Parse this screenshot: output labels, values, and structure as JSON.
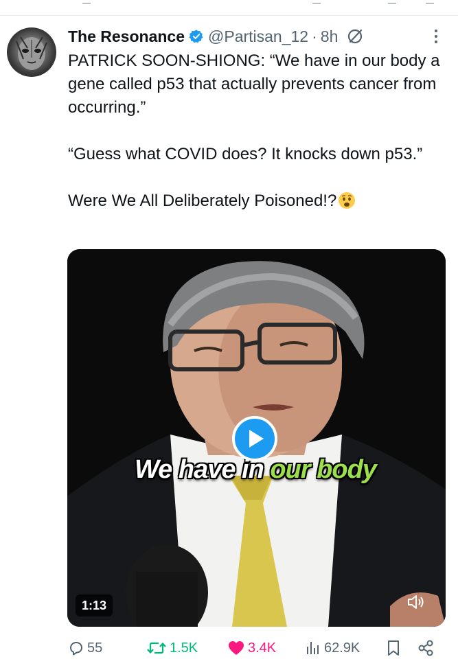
{
  "post": {
    "author_name": "The Resonance",
    "handle": "@Partisan_12",
    "separator": "·",
    "time": "8h",
    "text_line1": "PATRICK SOON-SHIONG: “We have in our body a gene called p53 that actually prevents cancer from occurring.”",
    "text_line2": "“Guess what COVID does? It knocks down p53.”",
    "text_line3": "Were We All Deliberately Poisoned!?",
    "emoji": "worried-face-emoji"
  },
  "media": {
    "caption_white": "We have in",
    "caption_green": "our body",
    "duration": "1:13",
    "caption_green_color": "#9be04c"
  },
  "actions": {
    "replies": "55",
    "reposts": "1.5K",
    "likes": "3.4K",
    "views": "62.9K"
  },
  "colors": {
    "accent": "#1d9bf0",
    "repost": "#00ba7c",
    "like": "#f91880",
    "muted": "#536471"
  }
}
